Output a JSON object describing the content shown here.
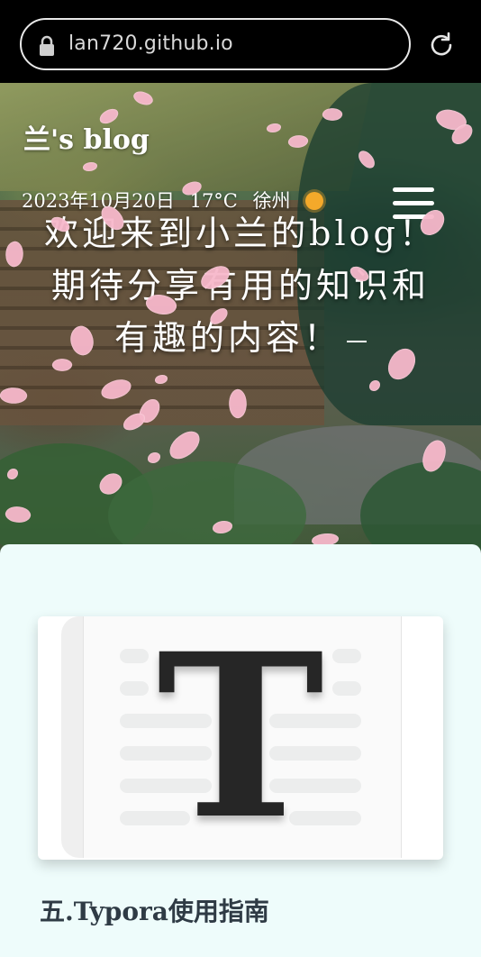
{
  "browser": {
    "url": "lan720.github.io"
  },
  "hero": {
    "blog_title": "兰's blog",
    "date": "2023年10月20日",
    "temperature": "17°C",
    "city": "徐州",
    "weather_icon": "sun-icon",
    "welcome_text": "欢迎来到小兰的blog！期待分享有用的知识和有趣的内容！"
  },
  "post": {
    "title": "五.Typora使用指南",
    "thumbnail_letter": "T"
  },
  "colors": {
    "card_background": "#eefcfb",
    "petal": "#f7b8cb",
    "sun": "#f4a92a"
  }
}
